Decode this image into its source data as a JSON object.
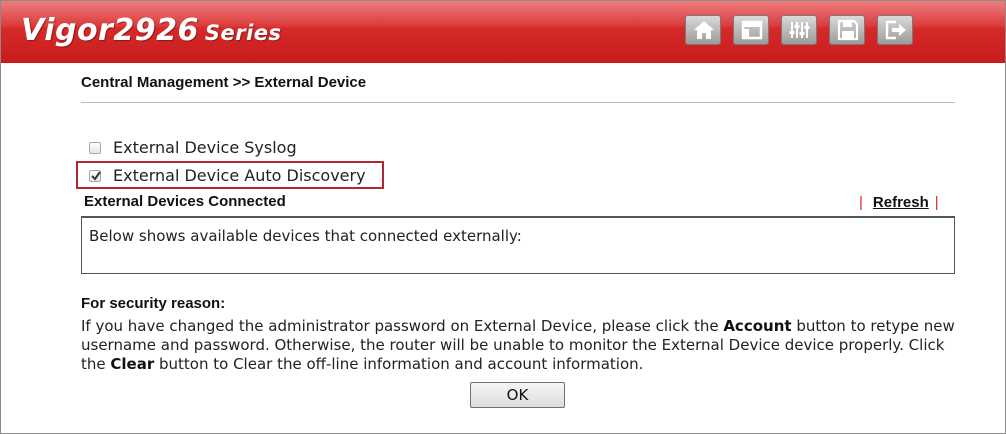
{
  "header": {
    "logo_main": "Vigor2926",
    "logo_series": "Series",
    "toolbar_icons": [
      "home-icon",
      "layout-icon",
      "sliders-icon",
      "save-icon",
      "logout-icon"
    ]
  },
  "breadcrumb": "Central Management >> External Device",
  "options": {
    "syslog": {
      "label": "External Device Syslog",
      "checked": false
    },
    "auto_discovery": {
      "label": "External Device Auto Discovery",
      "checked": true
    }
  },
  "connected": {
    "title": "External Devices Connected",
    "refresh_label": "Refresh",
    "separator": "|",
    "box_text": "Below shows available devices that connected externally:"
  },
  "security": {
    "heading": "For security reason:",
    "text_1": "If you have changed the administrator password on External Device, please click the ",
    "account_word": "Account",
    "text_2": " button to retype new username and password. Otherwise, the router will be unable to monitor the External Device device properly. Click the ",
    "clear_word": "Clear",
    "text_3": " button to Clear the off-line information and account information."
  },
  "ok_label": "OK",
  "colors": {
    "brand_red": "#d62a2a",
    "highlight_border": "#b0282e"
  }
}
